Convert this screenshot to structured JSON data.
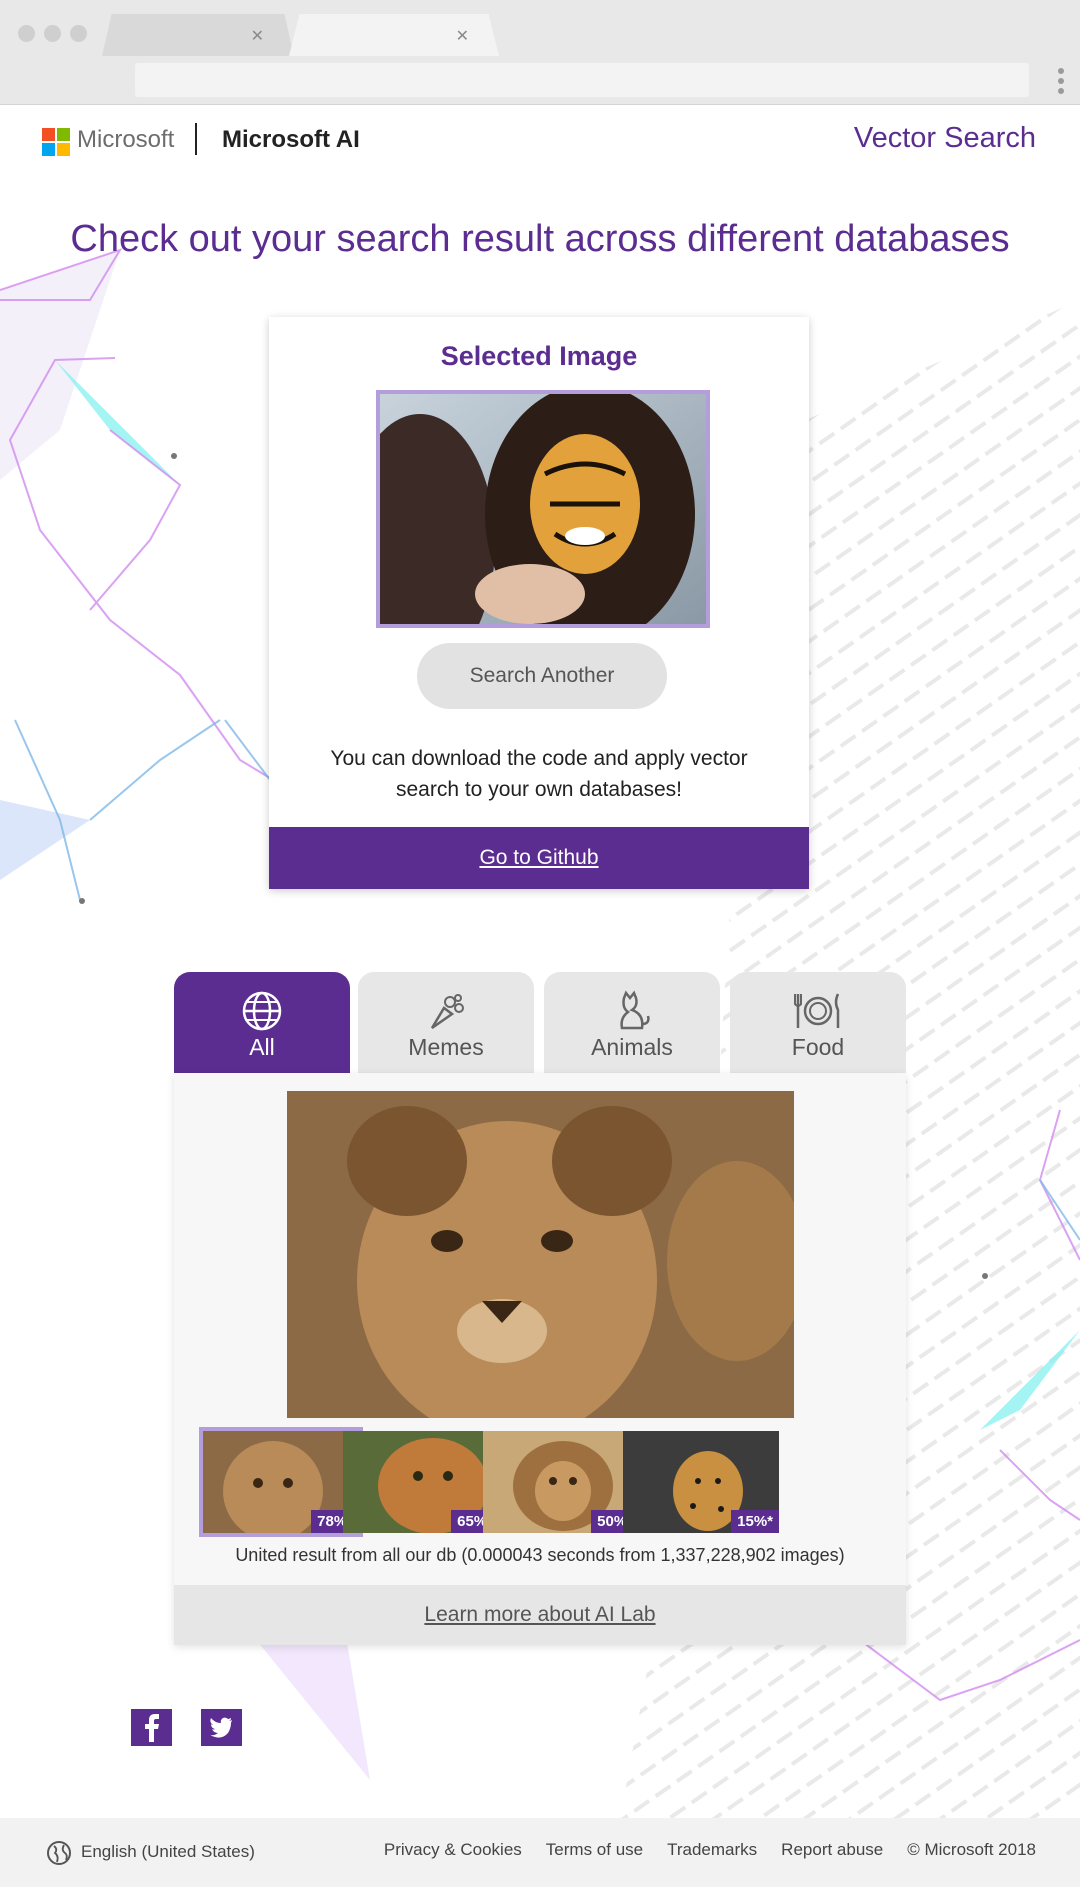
{
  "header": {
    "brand_company": "Microsoft",
    "brand_product": "Microsoft AI",
    "nav_link": "Vector Search"
  },
  "headline": "Check out your search result across different databases",
  "selected": {
    "title": "Selected Image",
    "search_another": "Search Another",
    "description": "You can download the code and apply vector search to your own databases!",
    "github_link": "Go to Github"
  },
  "tabs": [
    {
      "label": "All",
      "icon": "globe-icon"
    },
    {
      "label": "Memes",
      "icon": "bouquet-icon"
    },
    {
      "label": "Animals",
      "icon": "cat-icon"
    },
    {
      "label": "Food",
      "icon": "plate-cutlery-icon"
    }
  ],
  "results": {
    "thumbnails": [
      {
        "score": "78%*"
      },
      {
        "score": "65%*"
      },
      {
        "score": "50%*"
      },
      {
        "score": "15%*"
      }
    ],
    "caption": "United result from all our db (0.000043 seconds from 1,337,228,902 images)",
    "learn_more": "Learn more about AI Lab"
  },
  "footer": {
    "locale": "English (United States)",
    "links": [
      "Privacy & Cookies",
      "Terms of use",
      "Trademarks",
      "Report abuse",
      "© Microsoft 2018"
    ]
  },
  "colors": {
    "accent": "#5c2d91",
    "highlight_border": "#b39ddb"
  }
}
